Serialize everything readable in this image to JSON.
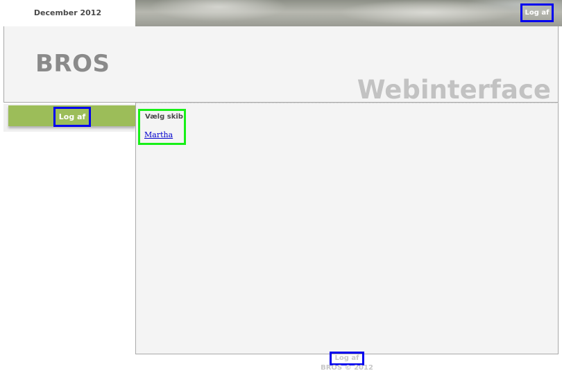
{
  "top": {
    "date": "December 2012",
    "logout_label": "Log af"
  },
  "header": {
    "brand": "BROS",
    "subtitle": "Webinterface"
  },
  "sidebar": {
    "logout_label": "Log af"
  },
  "content": {
    "heading": "Vælg skib",
    "ships": [
      "Martha"
    ]
  },
  "footer": {
    "logout_label": "Log af",
    "copyright": "BROS © 2012"
  },
  "colors": {
    "menu_bar": "#9cbd59",
    "panel": "#f4f4f4",
    "link": "#0000cc",
    "highlight_blue": "#0000ee",
    "highlight_green": "#17f017"
  }
}
